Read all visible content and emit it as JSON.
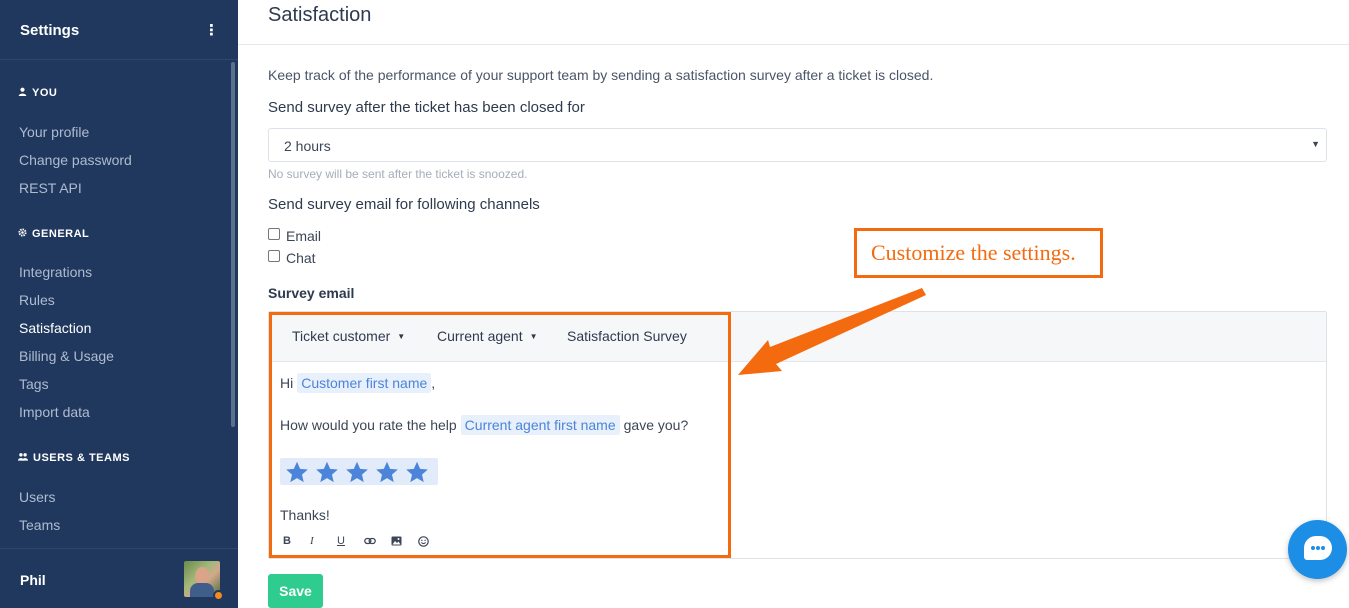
{
  "sidebar": {
    "title": "Settings",
    "kebab": "⋮",
    "sections": [
      {
        "label": "YOU",
        "icon": "user-icon",
        "items": [
          "Your profile",
          "Change password",
          "REST API"
        ]
      },
      {
        "label": "GENERAL",
        "icon": "gear-icon",
        "items": [
          "Integrations",
          "Rules",
          "Satisfaction",
          "Billing & Usage",
          "Tags",
          "Import data"
        ]
      },
      {
        "label": "USERS & TEAMS",
        "icon": "users-icon",
        "items": [
          "Users",
          "Teams"
        ]
      }
    ],
    "active_item": "Satisfaction",
    "user": {
      "name": "Phil",
      "status_color": "#f68b1f"
    }
  },
  "main": {
    "title": "Satisfaction",
    "description": "Keep track of the performance of your support team by sending a satisfaction survey after a ticket is closed.",
    "delay_label": "Send survey after the ticket has been closed for",
    "delay_value": "2 hours",
    "delay_hint": "No survey will be sent after the ticket is snoozed.",
    "channels_label": "Send survey email for following channels",
    "channels": [
      {
        "label": "Email",
        "checked": false
      },
      {
        "label": "Chat",
        "checked": false
      }
    ],
    "survey_label": "Survey email",
    "editor": {
      "toolbar": {
        "ticket_customer": "Ticket customer",
        "current_agent": "Current agent",
        "satisfaction_survey": "Satisfaction Survey"
      },
      "greeting_prefix": "Hi",
      "customer_chip": "Customer first name",
      "greeting_suffix": ",",
      "question_prefix": "How would you rate the help",
      "agent_chip": "Current agent first name",
      "question_suffix": "gave you?",
      "stars": 5,
      "star_color": "#4c84d9",
      "thanks": "Thanks!",
      "format_tools": [
        "B",
        "I",
        "U"
      ]
    },
    "save_label": "Save"
  },
  "annotation": {
    "callout_text": "Customize the settings.",
    "color": "#f46a0f"
  },
  "colors": {
    "sidebar_bg": "#20385e",
    "accent_green": "#2ecc8f",
    "chat_blue": "#1d8ee6"
  }
}
